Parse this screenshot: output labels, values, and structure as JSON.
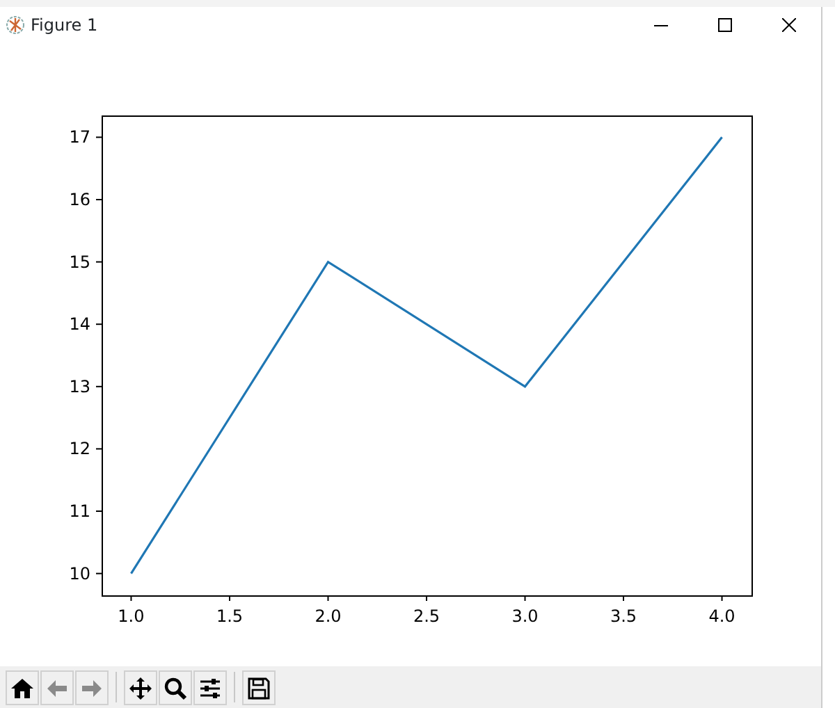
{
  "window": {
    "title": "Figure 1"
  },
  "chart_data": {
    "type": "line",
    "x": [
      1,
      2,
      3,
      4
    ],
    "series": [
      {
        "color": "#1f77b4",
        "values": [
          10,
          15,
          13,
          17
        ]
      }
    ],
    "xlim": [
      0.85,
      4.15
    ],
    "ylim": [
      9.65,
      17.35
    ],
    "xticks": [
      {
        "value": 1,
        "label": "1.0"
      },
      {
        "value": 1.5,
        "label": "1.5"
      },
      {
        "value": 2,
        "label": "2.0"
      },
      {
        "value": 2.5,
        "label": "2.5"
      },
      {
        "value": 3,
        "label": "3.0"
      },
      {
        "value": 3.5,
        "label": "3.5"
      },
      {
        "value": 4,
        "label": "4.0"
      }
    ],
    "yticks": [
      10,
      11,
      12,
      13,
      14,
      15,
      16,
      17
    ]
  },
  "toolbar": [
    {
      "kind": "home",
      "disabled": false
    },
    {
      "kind": "back",
      "disabled": true
    },
    {
      "kind": "forward",
      "disabled": true
    },
    {
      "kind": "separator"
    },
    {
      "kind": "pan",
      "disabled": false
    },
    {
      "kind": "zoom",
      "disabled": false
    },
    {
      "kind": "configure",
      "disabled": false
    },
    {
      "kind": "separator"
    },
    {
      "kind": "save",
      "disabled": false
    }
  ]
}
